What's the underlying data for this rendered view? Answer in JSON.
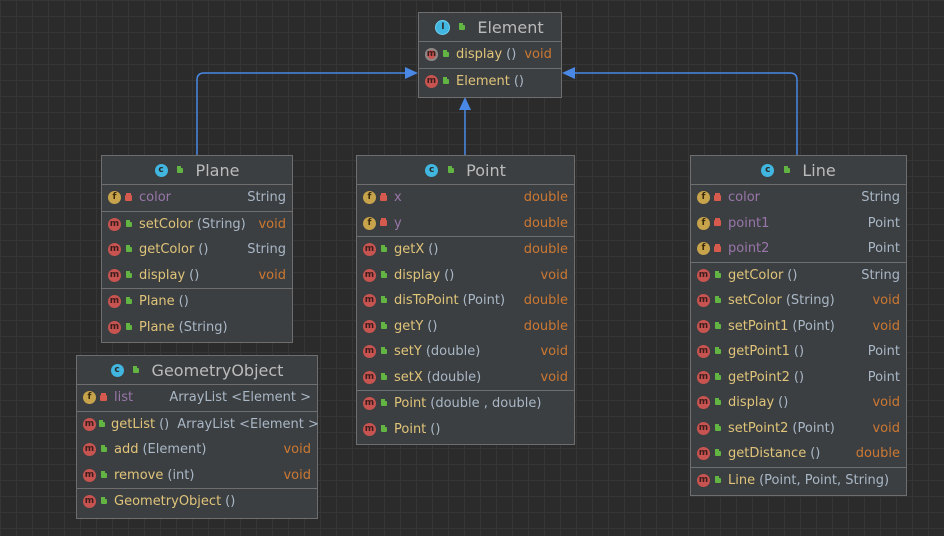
{
  "colors": {
    "background": "#2b2b2b",
    "box": "#3c3f41",
    "border": "#6e6e6e",
    "arrow": "#4a88e5"
  },
  "diagram": {
    "element": {
      "title": "Element",
      "icon": "interface-icon",
      "methods": [
        {
          "name": "display",
          "params": "()",
          "type": "void"
        }
      ],
      "constructors": [
        {
          "name": "Element",
          "params": "()"
        }
      ]
    },
    "plane": {
      "title": "Plane",
      "icon": "class-icon",
      "fields": [
        {
          "name": "color",
          "type": "String"
        }
      ],
      "methods": [
        {
          "name": "setColor",
          "params": "(String)",
          "type": "void"
        },
        {
          "name": "getColor",
          "params": "()",
          "type": "String"
        },
        {
          "name": "display",
          "params": "()",
          "type": "void"
        }
      ],
      "constructors": [
        {
          "name": "Plane",
          "params": "()"
        },
        {
          "name": "Plane",
          "params": "(String)"
        }
      ]
    },
    "point": {
      "title": "Point",
      "icon": "class-icon",
      "fields": [
        {
          "name": "x",
          "type": "double"
        },
        {
          "name": "y",
          "type": "double"
        }
      ],
      "methods": [
        {
          "name": "getX",
          "params": "()",
          "type": "double"
        },
        {
          "name": "display",
          "params": "()",
          "type": "void"
        },
        {
          "name": "disToPoint",
          "params": "(Point)",
          "type": "double"
        },
        {
          "name": "getY",
          "params": "()",
          "type": "double"
        },
        {
          "name": "setY",
          "params": "(double)",
          "type": "void"
        },
        {
          "name": "setX",
          "params": "(double)",
          "type": "void"
        }
      ],
      "constructors": [
        {
          "name": "Point",
          "params": "(double , double)"
        },
        {
          "name": "Point",
          "params": "()"
        }
      ]
    },
    "line": {
      "title": "Line",
      "icon": "class-icon",
      "fields": [
        {
          "name": "color",
          "type": "String"
        },
        {
          "name": "point1",
          "type": "Point"
        },
        {
          "name": "point2",
          "type": "Point"
        }
      ],
      "methods": [
        {
          "name": "getColor",
          "params": "()",
          "type": "String"
        },
        {
          "name": "setColor",
          "params": "(String)",
          "type": "void"
        },
        {
          "name": "setPoint1",
          "params": "(Point)",
          "type": "void"
        },
        {
          "name": "getPoint1",
          "params": "()",
          "type": "Point"
        },
        {
          "name": "getPoint2",
          "params": "()",
          "type": "Point"
        },
        {
          "name": "display",
          "params": "()",
          "type": "void"
        },
        {
          "name": "setPoint2",
          "params": "(Point)",
          "type": "void"
        },
        {
          "name": "getDistance",
          "params": "()",
          "type": "double"
        }
      ],
      "constructors": [
        {
          "name": "Line",
          "params": "(Point, Point, String)"
        }
      ]
    },
    "geometry": {
      "title": "GeometryObject",
      "icon": "class-icon",
      "fields": [
        {
          "name": "list",
          "type": "ArrayList <Element >"
        }
      ],
      "methods": [
        {
          "name": "getList",
          "params": "()",
          "type": "ArrayList <Element >"
        },
        {
          "name": "add",
          "params": "(Element)",
          "type": "void"
        },
        {
          "name": "remove",
          "params": "(int)",
          "type": "void"
        }
      ],
      "constructors": [
        {
          "name": "GeometryObject",
          "params": "()"
        }
      ]
    }
  }
}
